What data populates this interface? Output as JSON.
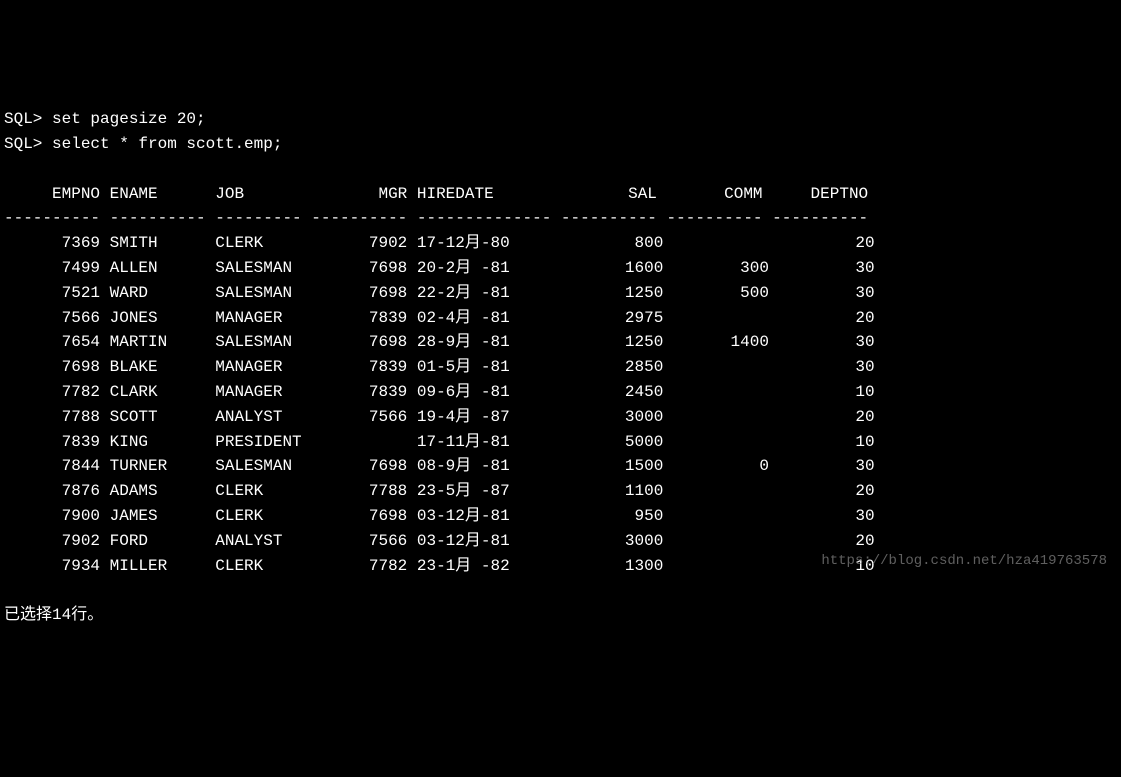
{
  "prompt": "SQL>",
  "commands": [
    "set pagesize 20;",
    "select * from scott.emp;"
  ],
  "columns": [
    "EMPNO",
    "ENAME",
    "JOB",
    "MGR",
    "HIREDATE",
    "SAL",
    "COMM",
    "DEPTNO"
  ],
  "rows": [
    {
      "empno": "7369",
      "ename": "SMITH",
      "job": "CLERK",
      "mgr": "7902",
      "hiredate": "17-12月-80",
      "sal": "800",
      "comm": "",
      "deptno": "20"
    },
    {
      "empno": "7499",
      "ename": "ALLEN",
      "job": "SALESMAN",
      "mgr": "7698",
      "hiredate": "20-2月 -81",
      "sal": "1600",
      "comm": "300",
      "deptno": "30"
    },
    {
      "empno": "7521",
      "ename": "WARD",
      "job": "SALESMAN",
      "mgr": "7698",
      "hiredate": "22-2月 -81",
      "sal": "1250",
      "comm": "500",
      "deptno": "30"
    },
    {
      "empno": "7566",
      "ename": "JONES",
      "job": "MANAGER",
      "mgr": "7839",
      "hiredate": "02-4月 -81",
      "sal": "2975",
      "comm": "",
      "deptno": "20"
    },
    {
      "empno": "7654",
      "ename": "MARTIN",
      "job": "SALESMAN",
      "mgr": "7698",
      "hiredate": "28-9月 -81",
      "sal": "1250",
      "comm": "1400",
      "deptno": "30"
    },
    {
      "empno": "7698",
      "ename": "BLAKE",
      "job": "MANAGER",
      "mgr": "7839",
      "hiredate": "01-5月 -81",
      "sal": "2850",
      "comm": "",
      "deptno": "30"
    },
    {
      "empno": "7782",
      "ename": "CLARK",
      "job": "MANAGER",
      "mgr": "7839",
      "hiredate": "09-6月 -81",
      "sal": "2450",
      "comm": "",
      "deptno": "10"
    },
    {
      "empno": "7788",
      "ename": "SCOTT",
      "job": "ANALYST",
      "mgr": "7566",
      "hiredate": "19-4月 -87",
      "sal": "3000",
      "comm": "",
      "deptno": "20"
    },
    {
      "empno": "7839",
      "ename": "KING",
      "job": "PRESIDENT",
      "mgr": "",
      "hiredate": "17-11月-81",
      "sal": "5000",
      "comm": "",
      "deptno": "10"
    },
    {
      "empno": "7844",
      "ename": "TURNER",
      "job": "SALESMAN",
      "mgr": "7698",
      "hiredate": "08-9月 -81",
      "sal": "1500",
      "comm": "0",
      "deptno": "30"
    },
    {
      "empno": "7876",
      "ename": "ADAMS",
      "job": "CLERK",
      "mgr": "7788",
      "hiredate": "23-5月 -87",
      "sal": "1100",
      "comm": "",
      "deptno": "20"
    },
    {
      "empno": "7900",
      "ename": "JAMES",
      "job": "CLERK",
      "mgr": "7698",
      "hiredate": "03-12月-81",
      "sal": "950",
      "comm": "",
      "deptno": "30"
    },
    {
      "empno": "7902",
      "ename": "FORD",
      "job": "ANALYST",
      "mgr": "7566",
      "hiredate": "03-12月-81",
      "sal": "3000",
      "comm": "",
      "deptno": "20"
    },
    {
      "empno": "7934",
      "ename": "MILLER",
      "job": "CLERK",
      "mgr": "7782",
      "hiredate": "23-1月 -82",
      "sal": "1300",
      "comm": "",
      "deptno": "10"
    }
  ],
  "footer": "已选择14行。",
  "watermark": "https://blog.csdn.net/hza419763578",
  "chart_data": {
    "type": "table",
    "title": "scott.emp",
    "columns": [
      "EMPNO",
      "ENAME",
      "JOB",
      "MGR",
      "HIREDATE",
      "SAL",
      "COMM",
      "DEPTNO"
    ],
    "rows": [
      [
        7369,
        "SMITH",
        "CLERK",
        7902,
        "17-12月-80",
        800,
        null,
        20
      ],
      [
        7499,
        "ALLEN",
        "SALESMAN",
        7698,
        "20-2月 -81",
        1600,
        300,
        30
      ],
      [
        7521,
        "WARD",
        "SALESMAN",
        7698,
        "22-2月 -81",
        1250,
        500,
        30
      ],
      [
        7566,
        "JONES",
        "MANAGER",
        7839,
        "02-4月 -81",
        2975,
        null,
        20
      ],
      [
        7654,
        "MARTIN",
        "SALESMAN",
        7698,
        "28-9月 -81",
        1250,
        1400,
        30
      ],
      [
        7698,
        "BLAKE",
        "MANAGER",
        7839,
        "01-5月 -81",
        2850,
        null,
        30
      ],
      [
        7782,
        "CLARK",
        "MANAGER",
        7839,
        "09-6月 -81",
        2450,
        null,
        10
      ],
      [
        7788,
        "SCOTT",
        "ANALYST",
        7566,
        "19-4月 -87",
        3000,
        null,
        20
      ],
      [
        7839,
        "KING",
        "PRESIDENT",
        null,
        "17-11月-81",
        5000,
        null,
        10
      ],
      [
        7844,
        "TURNER",
        "SALESMAN",
        7698,
        "08-9月 -81",
        1500,
        0,
        30
      ],
      [
        7876,
        "ADAMS",
        "CLERK",
        7788,
        "23-5月 -87",
        1100,
        null,
        20
      ],
      [
        7900,
        "JAMES",
        "CLERK",
        7698,
        "03-12月-81",
        950,
        null,
        30
      ],
      [
        7902,
        "FORD",
        "ANALYST",
        7566,
        "03-12月-81",
        3000,
        null,
        20
      ],
      [
        7934,
        "MILLER",
        "CLERK",
        7782,
        "23-1月 -82",
        1300,
        null,
        10
      ]
    ]
  }
}
